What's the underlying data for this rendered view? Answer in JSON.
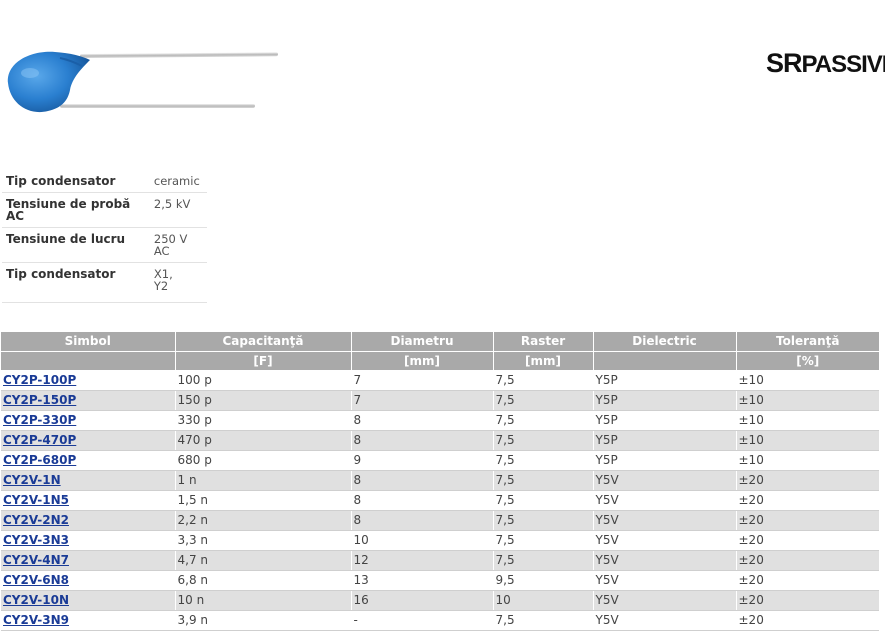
{
  "header": {
    "logo_text_sr": "SR",
    "logo_text_rest": "PASSIVES",
    "product_image": "blue-ceramic-disc-capacitor"
  },
  "specs": [
    {
      "label": "Tip condensator",
      "value": "ceramic"
    },
    {
      "label": "Tensiune de probă AC",
      "value": "2,5 kV"
    },
    {
      "label": "Tensiune de lucru",
      "value": "250 V AC"
    },
    {
      "label": "Tip condensator",
      "value_line1": "X1,",
      "value_line2": "Y2"
    }
  ],
  "table": {
    "headers": [
      "Simbol",
      "Capacitanţă",
      "Diametru",
      "Raster",
      "Dielectric",
      "Toleranţă"
    ],
    "units": [
      "",
      "[F]",
      "[mm]",
      "[mm]",
      "",
      "[%]"
    ],
    "rows": [
      [
        "CY2P-100P",
        "100 p",
        "7",
        "7,5",
        "Y5P",
        "±10"
      ],
      [
        "CY2P-150P",
        "150 p",
        "7",
        "7,5",
        "Y5P",
        "±10"
      ],
      [
        "CY2P-330P",
        "330 p",
        "8",
        "7,5",
        "Y5P",
        "±10"
      ],
      [
        "CY2P-470P",
        "470 p",
        "8",
        "7,5",
        "Y5P",
        "±10"
      ],
      [
        "CY2P-680P",
        "680 p",
        "9",
        "7,5",
        "Y5P",
        "±10"
      ],
      [
        "CY2V-1N",
        "1 n",
        "8",
        "7,5",
        "Y5V",
        "±20"
      ],
      [
        "CY2V-1N5",
        "1,5 n",
        "8",
        "7,5",
        "Y5V",
        "±20"
      ],
      [
        "CY2V-2N2",
        "2,2 n",
        "8",
        "7,5",
        "Y5V",
        "±20"
      ],
      [
        "CY2V-3N3",
        "3,3 n",
        "10",
        "7,5",
        "Y5V",
        "±20"
      ],
      [
        "CY2V-4N7",
        "4,7 n",
        "12",
        "7,5",
        "Y5V",
        "±20"
      ],
      [
        "CY2V-6N8",
        "6,8 n",
        "13",
        "9,5",
        "Y5V",
        "±20"
      ],
      [
        "CY2V-10N",
        "10 n",
        "16",
        "10",
        "Y5V",
        "±20"
      ],
      [
        "CY2V-3N9",
        "3,9 n",
        "-",
        "7,5",
        "Y5V",
        "±20"
      ]
    ]
  },
  "colors": {
    "header_bg": "#a9a9a9",
    "row_alt_bg": "#e0e0e0",
    "link": "#1a3b96",
    "capacitor_blue": "#2a7fd0"
  }
}
